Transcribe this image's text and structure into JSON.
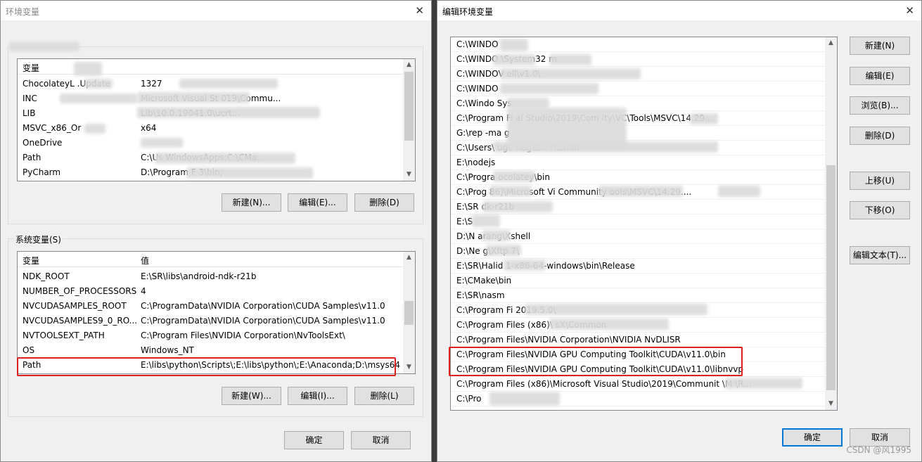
{
  "left_dialog": {
    "title": "环境变量",
    "close_glyph": "✕",
    "user_list": {
      "header_var": "变量",
      "rows": [
        {
          "name": "ChocolateyL      .Update",
          "value": "1327"
        },
        {
          "name": "INC",
          "value": "                  Microsoft Visual St      019\\Commu..."
        },
        {
          "name": "LIB",
          "value": "                                    Lib\\10.0.19041.0\\ucrt..."
        },
        {
          "name": "MSVC_x86_Or",
          "value": "x64"
        },
        {
          "name": "OneDrive",
          "value": ""
        },
        {
          "name": "Path",
          "value": "C:\\Us                                 WindowsApps;C:\\CMa..."
        },
        {
          "name": "PyCharm",
          "value": "D:\\Program F                      3\\bin;"
        }
      ],
      "btn_new": "新建(N)...",
      "btn_edit": "编辑(E)...",
      "btn_delete": "删除(D)"
    },
    "system_group_label": "系统变量(S)",
    "system_list": {
      "header_var": "变量",
      "header_val": "值",
      "rows": [
        {
          "name": "NDK_ROOT",
          "value": "E:\\SR\\libs\\android-ndk-r21b"
        },
        {
          "name": "NUMBER_OF_PROCESSORS",
          "value": "4"
        },
        {
          "name": "NVCUDASAMPLES_ROOT",
          "value": "C:\\ProgramData\\NVIDIA Corporation\\CUDA Samples\\v11.0"
        },
        {
          "name": "NVCUDASAMPLES9_0_RO...",
          "value": "C:\\ProgramData\\NVIDIA Corporation\\CUDA Samples\\v11.0"
        },
        {
          "name": "NVTOOLSEXT_PATH",
          "value": "C:\\Program Files\\NVIDIA Corporation\\NvToolsExt\\"
        },
        {
          "name": "OS",
          "value": "Windows_NT"
        },
        {
          "name": "Path",
          "value": "E:\\libs\\python\\Scripts\\;E:\\libs\\python\\;E:\\Anaconda;D:\\msys64..."
        }
      ],
      "btn_new": "新建(W)...",
      "btn_edit": "编辑(I)...",
      "btn_delete": "删除(L)"
    },
    "btn_ok": "确定",
    "btn_cancel": "取消"
  },
  "right_dialog": {
    "title": "编辑环境变量",
    "close_glyph": "✕",
    "paths": [
      "C:\\WINDO",
      "C:\\WINDO       \\System32      m",
      "C:\\WINDOV                                    ell\\v1.0\\",
      "C:\\WINDO",
      "C:\\Windo      Sys",
      "C:\\Program Fi                  al Studio\\2019\\Com     ity\\VC\\Tools\\MSVC\\14.29....",
      "G:\\rep                         -ma              g",
      "C:\\Users\\       uge                 nuget.c   mandli",
      "E:\\nodejs",
      "C:\\Progra           ocolatey\\bin",
      "C:\\Prog           86)\\Microsoft Vi                 Community             ools\\MSVC\\14.29....",
      "E:\\SR                dk-r21b",
      "E:\\S",
      "D:\\N        arang\\Xshell",
      "D:\\Ne           g\\Xftp 7\\",
      "E:\\SR\\Halid          1-x86-64-windows\\bin\\Release",
      "E:\\CMake\\bin",
      "E:\\SR\\nasm",
      "C:\\Program Fi                                                    2019.5.0\\",
      "C:\\Program Files (x86)\\                          sX\\Common",
      "C:\\Program Files\\NVIDIA Corporation\\NVIDIA NvDLISR",
      "C:\\Program Files\\NVIDIA GPU Computing Toolkit\\CUDA\\v11.0\\bin",
      "C:\\Program Files\\NVIDIA GPU Computing Toolkit\\CUDA\\v11.0\\libnvvp",
      "C:\\Program Files (x86)\\Microsoft Visual Studio\\2019\\Communit  \\M                   \\R...",
      "C:\\Pro"
    ],
    "btn_new": "新建(N)",
    "btn_edit": "编辑(E)",
    "btn_browse": "浏览(B)...",
    "btn_delete": "删除(D)",
    "btn_up": "上移(U)",
    "btn_down": "下移(O)",
    "btn_edit_text": "编辑文本(T)...",
    "btn_ok": "确定",
    "btn_cancel": "取消"
  },
  "watermark": "CSDN @风1995"
}
